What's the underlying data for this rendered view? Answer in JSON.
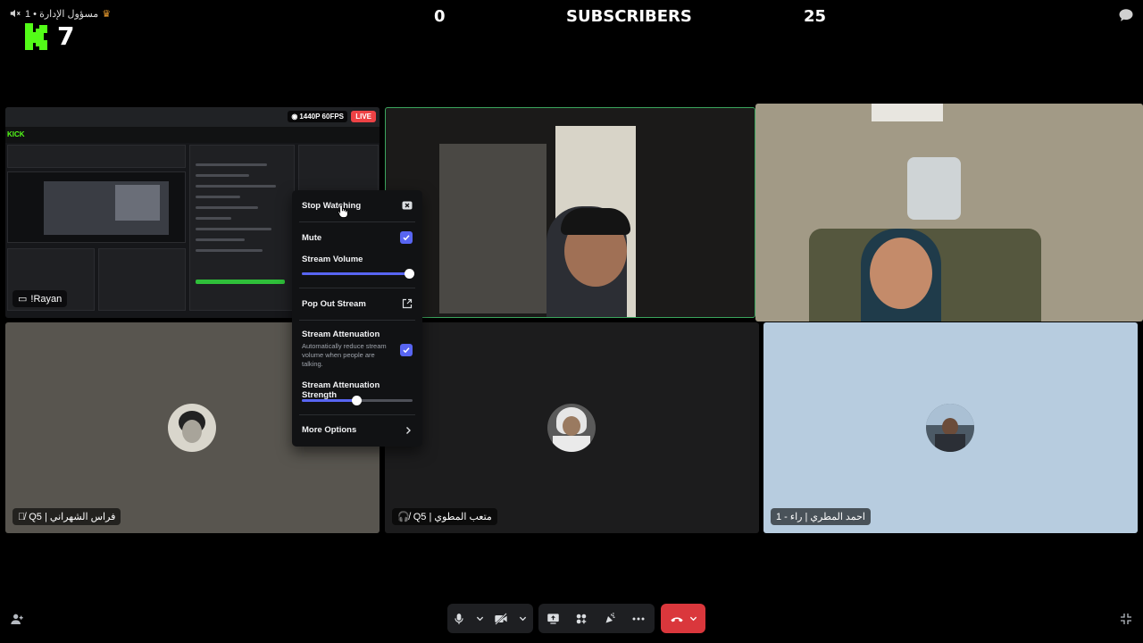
{
  "top": {
    "user_label": "مسؤول الإدارة • 1",
    "kick_count": "7",
    "stat_left": "0",
    "subscribers_label": "SUBSCRIBERS",
    "stat_right": "25"
  },
  "stream": {
    "resolution_badge": "1440P 60FPS",
    "live_badge": "LIVE",
    "streamer_name": "!Rayan",
    "mini_logo": "KICK"
  },
  "participants": [
    {
      "name": "فراس الشهراني | Q5"
    },
    {
      "name": "متعب المطوي | Q5"
    },
    {
      "name": "احمد المطري | راء - 1"
    }
  ],
  "menu": {
    "stop_watching": "Stop Watching",
    "mute": "Mute",
    "mute_checked": true,
    "stream_volume": "Stream Volume",
    "stream_volume_value": 1.0,
    "pop_out": "Pop Out Stream",
    "attenuation": "Stream Attenuation",
    "attenuation_desc": "Automatically reduce stream volume when people are talking.",
    "attenuation_checked": true,
    "attenuation_strength": "Stream Attenuation Strength",
    "attenuation_strength_value": 0.5,
    "more_options": "More Options"
  },
  "controls": {
    "icons": [
      "microphone-icon",
      "chevron-down-icon",
      "camera-off-icon",
      "chevron-down-icon",
      "screen-share-icon",
      "activities-icon",
      "soundboard-icon",
      "more-icon",
      "hang-up-icon",
      "chevron-down-icon"
    ]
  },
  "colors": {
    "accent": "#5865f2",
    "live": "#ed4245",
    "leave": "#da373c",
    "speaking": "#3ba55d",
    "kick_green": "#53fc18"
  }
}
